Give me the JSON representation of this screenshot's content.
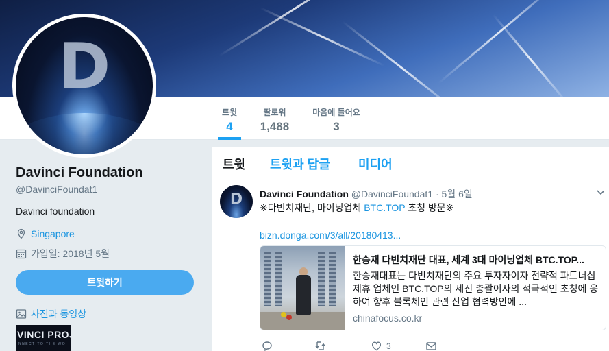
{
  "colors": {
    "accent": "#1da1f2",
    "link": "#1b95e0",
    "muted": "#657786",
    "button": "#4aaaf0"
  },
  "profile": {
    "name": "Davinci Foundation",
    "handle": "@DavinciFoundat1",
    "bio": "Davinci foundation",
    "location": "Singapore",
    "joined": "가입일: 2018년 5월",
    "tweet_button": "트윗하기",
    "media_link": "사진과 동영상",
    "avatar_letter": "D",
    "media_thumb_text": "VINCI PROJ",
    "media_thumb_subtext": "NNECT TO THE WO"
  },
  "stats": [
    {
      "label": "트윗",
      "value": "4",
      "active": true
    },
    {
      "label": "팔로워",
      "value": "1,488",
      "active": false
    },
    {
      "label": "마음에 들어요",
      "value": "3",
      "active": false
    }
  ],
  "tabs": [
    {
      "label": "트윗",
      "active": true
    },
    {
      "label": "트윗과 답글",
      "active": false
    },
    {
      "label": "미디어",
      "active": false
    }
  ],
  "tweet": {
    "name": "Davinci Foundation",
    "handle": "@DavinciFoundat1",
    "separator": "·",
    "date": "5월 6일",
    "text_before": "※다빈치재단, 마이닝업체 ",
    "text_link": "BTC.TOP",
    "text_after": " 초청 방문※",
    "link": "bizn.donga.com/3/all/20180413...",
    "card": {
      "title": "한승재 다빈치재단 대표, 세계 3대 마이닝업체 BTC.TOP...",
      "description": "한승재대표는 다빈치재단의 주요 투자자이자 전략적 파트너십 제휴 업체인 BTC.TOP의 세진 총괄이사의 적극적인 초청에 응하여 향후 블록체인 관련 산업 협력방안에 ...",
      "domain": "chinafocus.co.kr"
    },
    "like_count": "3"
  }
}
